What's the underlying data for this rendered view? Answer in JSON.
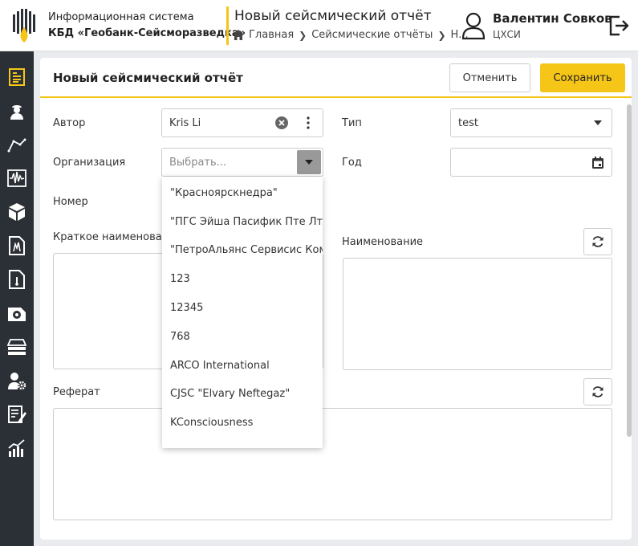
{
  "header": {
    "system_line1": "Информационная система",
    "system_line2": "КБД «Геобанк-Сейсморазведка»",
    "page_title": "Новый сейсмический отчёт",
    "breadcrumb": [
      "Главная",
      "Сейсмические отчёты",
      "Н..."
    ],
    "user_name": "Валентин Совков",
    "user_org": "ЦХСИ"
  },
  "sidebar": {
    "items": [
      "report-icon",
      "worker-icon",
      "route-icon",
      "seismogram-icon",
      "cube-icon",
      "document-chart-icon",
      "document-well-icon",
      "disk-icon",
      "layers-icon",
      "user-settings-icon",
      "edit-list-icon",
      "analytics-icon"
    ]
  },
  "card": {
    "title": "Новый сейсмический отчёт",
    "cancel_label": "Отменить",
    "save_label": "Сохранить"
  },
  "form": {
    "author_label": "Автор",
    "author_value": "Kris Li",
    "org_label": "Организация",
    "org_placeholder": "Выбрать...",
    "number_label": "Номер",
    "short_name_label": "Краткое наименован",
    "type_label": "Тип",
    "type_value": "test",
    "year_label": "Год",
    "year_value": "",
    "name_label": "Наименование",
    "abstract_label": "Реферат"
  },
  "org_dropdown": {
    "options": [
      "\"Красноярскнедра\"",
      "\"ПГС Эйша Пасифик Пте Лтд\"",
      "\"ПетроАльянс Сервисис Комп",
      "123",
      "12345",
      "768",
      "ARCO International",
      "CJSC \"Elvary Neftegaz\"",
      "KConsciousness"
    ]
  },
  "colors": {
    "accent": "#f5c518",
    "sidebar_bg": "#2b2f36",
    "sidebar_icon": "#ffffff",
    "sidebar_active_icon": "#f5c518"
  }
}
